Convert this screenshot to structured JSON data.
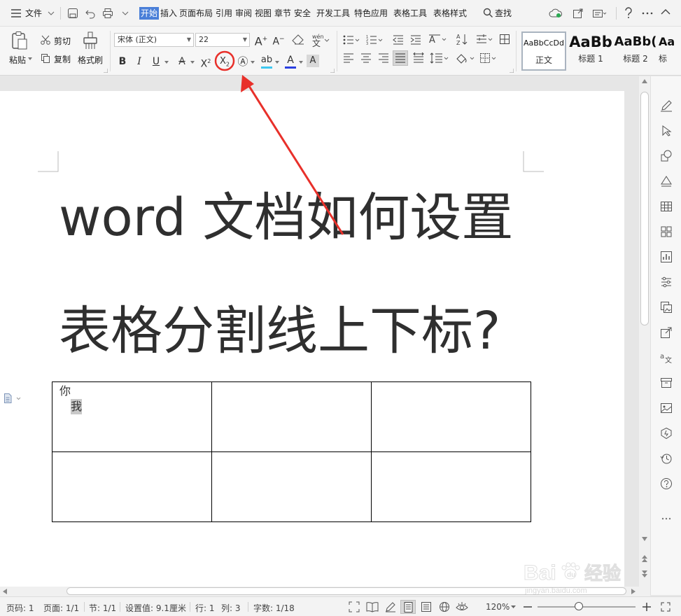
{
  "menubar": {
    "file_label": "文件",
    "tabs": [
      "开始",
      "插入",
      "页面布局",
      "引用",
      "审阅",
      "视图",
      "章节",
      "安全",
      "开发工具",
      "特色应用",
      "表格工具",
      "表格样式"
    ],
    "search_label": "查找"
  },
  "ribbon": {
    "paste": "粘贴",
    "cut": "剪切",
    "copy": "复制",
    "format_painter": "格式刷",
    "font_name": "宋体 (正文)",
    "font_size": "22",
    "styles": [
      {
        "sample": "AaBbCcDd",
        "name": "正文"
      },
      {
        "sample": "AaBb",
        "name": "标题 1"
      },
      {
        "sample": "AaBb(",
        "name": "标题 2"
      },
      {
        "sample": "Aa",
        "name": "标"
      }
    ]
  },
  "document": {
    "title_line1": "word 文档如何设置",
    "title_line2": "表格分割线上下标?",
    "cell_main": "你",
    "cell_sub": "我"
  },
  "statusbar": {
    "page_num": "页码: 1",
    "pages": "页面: 1/1",
    "section": "节: 1/1",
    "setting": "设置值: 9.1厘米",
    "row": "行: 1",
    "col": "列: 3",
    "words": "字数: 1/18",
    "zoom": "120%",
    "zoom_level": 0.42
  },
  "watermark": {
    "line1": "Baidu经验",
    "line2": "jingyan.baidu.com"
  },
  "colors": {
    "accent": "#4a7fd8",
    "annotation": "#e8302a"
  }
}
